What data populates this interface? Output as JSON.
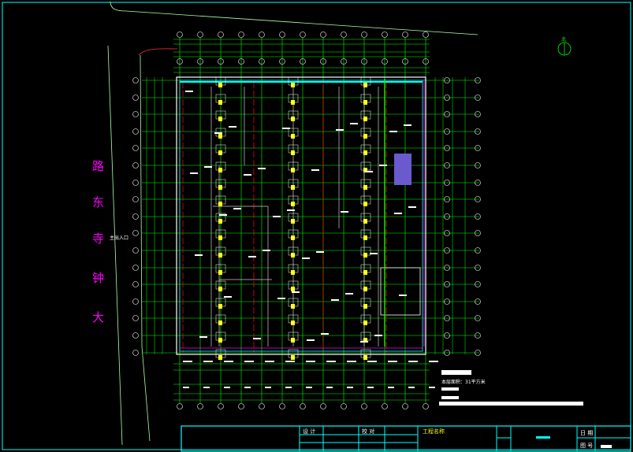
{
  "drawing": {
    "road_label": [
      "大",
      "钟",
      "寺",
      "东",
      "路"
    ],
    "entrance_label": "主出入口",
    "north_label": "北",
    "note_title": "",
    "note_text": "本层面积：31平方米",
    "title_block": {
      "project_label": "工程名称",
      "col_a": "设 计",
      "col_b": "校 对",
      "sheet_label": "图 号",
      "date_label": "日 期",
      "drawing_name": "",
      "sheet_no": ""
    }
  },
  "colors": {
    "background": "#000000",
    "frame": "#00ffff",
    "grid": "#00ff00",
    "axis": "#ff0000",
    "wall": "#ffffff",
    "column": "#ffff00",
    "road_text": "#ff00ff",
    "purple": "#6a5acd",
    "magenta": "#ff00ff"
  }
}
